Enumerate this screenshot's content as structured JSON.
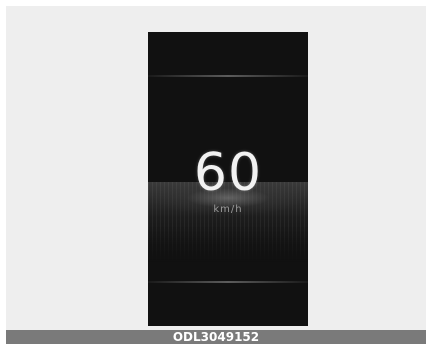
{
  "display": {
    "speed_value": "60",
    "speed_unit": "km/h"
  },
  "caption": {
    "code": "ODL3049152"
  }
}
